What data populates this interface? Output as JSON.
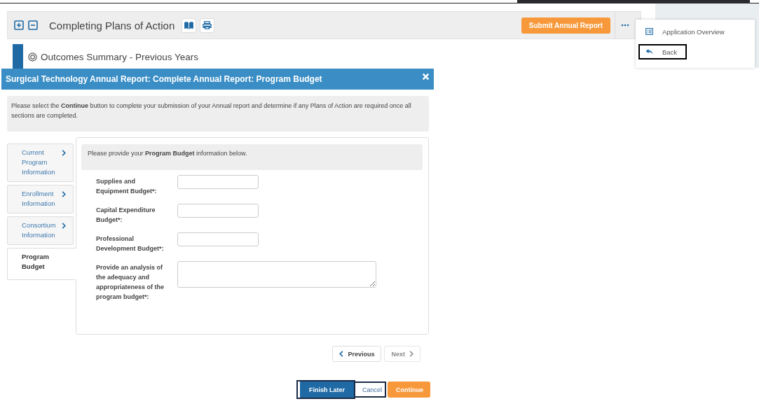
{
  "page_header": {
    "title": "Completing Plans of Action",
    "submit_button": "Submit Annual Report"
  },
  "section": {
    "title": "Outcomes Summary - Previous Years"
  },
  "menu": {
    "items": [
      {
        "kind": "overview",
        "label": "Application Overview",
        "focused": false
      },
      {
        "kind": "back",
        "label": "Back",
        "focused": true
      }
    ]
  },
  "modal": {
    "title": "Surgical Technology Annual Report: Complete Annual Report: Program Budget",
    "notice": "Please select the **Continue** button to complete your submission of your Annual report and determine if any Plans of Action are required once all sections are completed.",
    "tabs": [
      {
        "label": "Current Program Information",
        "selected": false
      },
      {
        "label": "Enrollment Information",
        "selected": false
      },
      {
        "label": "Consortium Information",
        "selected": false
      },
      {
        "label": "Program Budget",
        "selected": true
      }
    ],
    "intro": "Please provide your **Program Budget** information below.",
    "fields": [
      {
        "kind": "input",
        "label": "Supplies and Equipment Budget*:"
      },
      {
        "kind": "input",
        "label": "Capital Expenditure Budget*:"
      },
      {
        "kind": "input",
        "label": "Professional Development Budget*:"
      },
      {
        "kind": "textarea",
        "label": "Provide an analysis of the adequacy and appropriateness of the program budget*:"
      }
    ],
    "pager": [
      {
        "kind": "previous",
        "label": "Previous",
        "disabled": false
      },
      {
        "kind": "next",
        "label": "Next",
        "disabled": true
      }
    ],
    "footer_buttons": [
      {
        "kind": "primary",
        "label": "Finish Later",
        "focused": true
      },
      {
        "kind": "plain",
        "label": "Cancel",
        "focused": true
      },
      {
        "kind": "accent",
        "label": "Continue",
        "focused": false
      }
    ]
  }
}
